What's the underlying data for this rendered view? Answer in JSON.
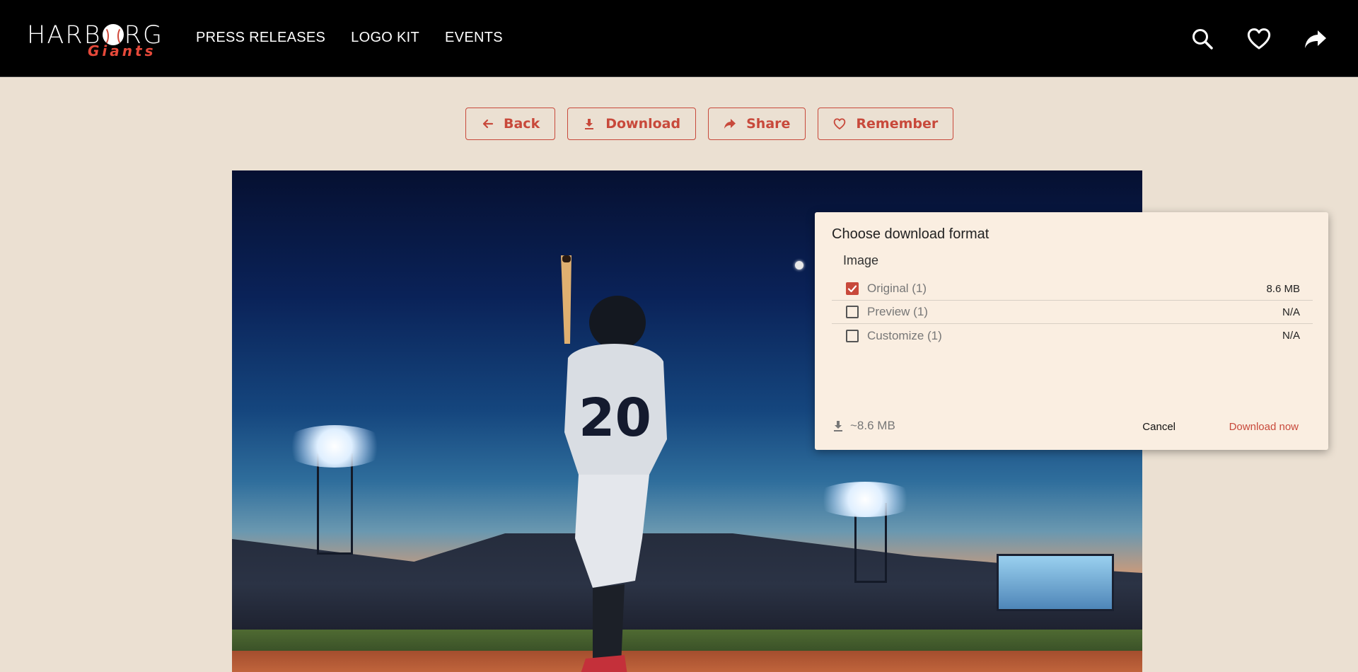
{
  "header": {
    "logo": {
      "text_before": "HARB",
      "text_after": "RG",
      "subtitle": "Giants"
    },
    "nav": [
      {
        "label": "PRESS RELEASES"
      },
      {
        "label": "LOGO KIT"
      },
      {
        "label": "EVENTS"
      }
    ],
    "icons": [
      "search-icon",
      "heart-icon",
      "share-icon"
    ]
  },
  "actions": {
    "back_label": "Back",
    "download_label": "Download",
    "share_label": "Share",
    "remember_label": "Remember"
  },
  "photo": {
    "subject": "baseball-batter-number-20",
    "jersey_number": "20"
  },
  "download_modal": {
    "title": "Choose download format",
    "section_label": "Image",
    "formats": [
      {
        "name": "Original (1)",
        "size": "8.6 MB",
        "checked": true
      },
      {
        "name": "Preview (1)",
        "size": "N/A",
        "checked": false
      },
      {
        "name": "Customize (1)",
        "size": "N/A",
        "checked": false
      }
    ],
    "total": "~8.6 MB",
    "cancel_label": "Cancel",
    "download_now_label": "Download now"
  },
  "colors": {
    "accent": "#c8493b",
    "header_bg": "#000000",
    "page_bg": "#ebe0d2",
    "modal_bg": "#faeee1"
  }
}
